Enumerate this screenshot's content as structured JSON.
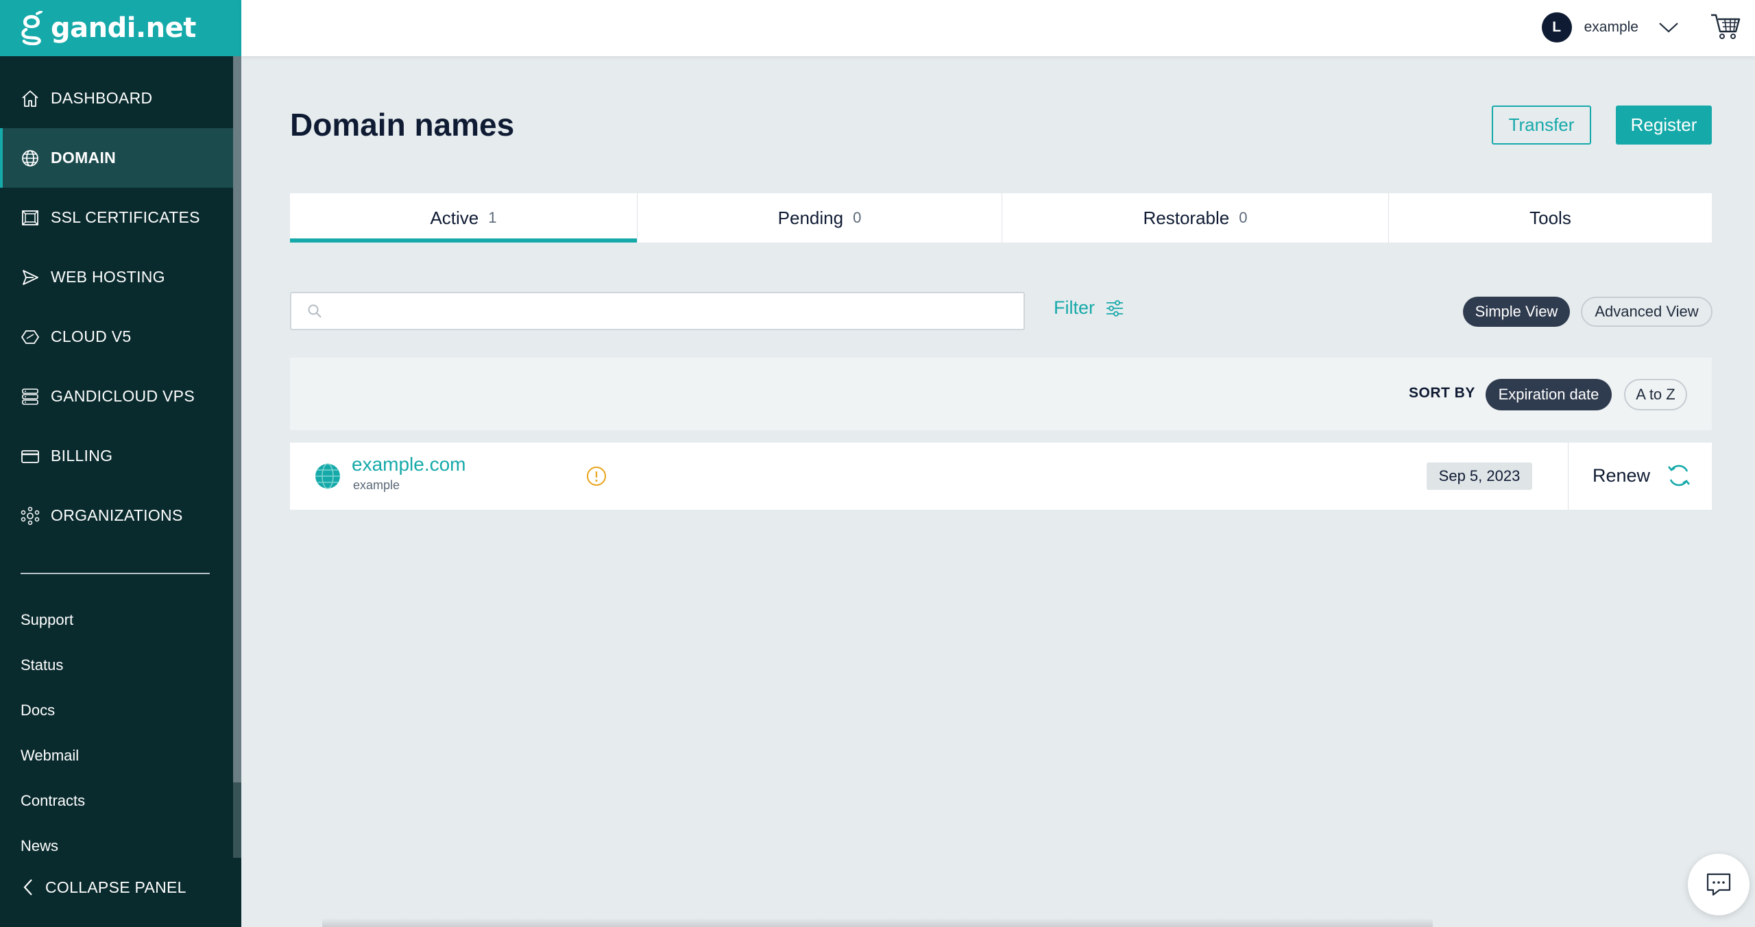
{
  "brand": {
    "name": "gandi.net"
  },
  "sidebar": {
    "items": [
      {
        "label": "DASHBOARD",
        "icon": "home-icon",
        "active": false
      },
      {
        "label": "DOMAIN",
        "icon": "globe-icon",
        "active": true
      },
      {
        "label": "SSL CERTIFICATES",
        "icon": "certificate-icon",
        "active": false
      },
      {
        "label": "WEB HOSTING",
        "icon": "send-icon",
        "active": false
      },
      {
        "label": "CLOUD V5",
        "icon": "cloud-hexagon-icon",
        "active": false
      },
      {
        "label": "GANDICLOUD VPS",
        "icon": "server-stack-icon",
        "active": false
      },
      {
        "label": "BILLING",
        "icon": "credit-card-icon",
        "active": false
      },
      {
        "label": "ORGANIZATIONS",
        "icon": "organization-icon",
        "active": false
      }
    ],
    "links": [
      "Support",
      "Status",
      "Docs",
      "Webmail",
      "Contracts",
      "News"
    ],
    "collapse_label": "COLLAPSE PANEL"
  },
  "header": {
    "avatar_initial": "L",
    "username": "example"
  },
  "main": {
    "title": "Domain names",
    "transfer_label": "Transfer",
    "register_label": "Register",
    "tabs": [
      {
        "label": "Active",
        "count": "1",
        "active": true
      },
      {
        "label": "Pending",
        "count": "0",
        "active": false
      },
      {
        "label": "Restorable",
        "count": "0",
        "active": false
      },
      {
        "label": "Tools",
        "count": "",
        "active": false
      }
    ],
    "search": {
      "placeholder": "",
      "value": ""
    },
    "filter_label": "Filter",
    "views": {
      "simple": "Simple View",
      "advanced": "Advanced View",
      "selected": "Simple View"
    },
    "sort": {
      "label": "SORT BY",
      "options": [
        "Expiration date",
        "A to Z"
      ],
      "selected": "Expiration date"
    },
    "domains": [
      {
        "name": "example.com",
        "owner": "example",
        "expires": "Sep 5, 2023",
        "renew_label": "Renew"
      }
    ]
  },
  "colors": {
    "accent": "#16a9a9",
    "sidebar_bg": "#0a2b2e",
    "dark_pill": "#2f3b4e",
    "warning": "#e8a317"
  }
}
